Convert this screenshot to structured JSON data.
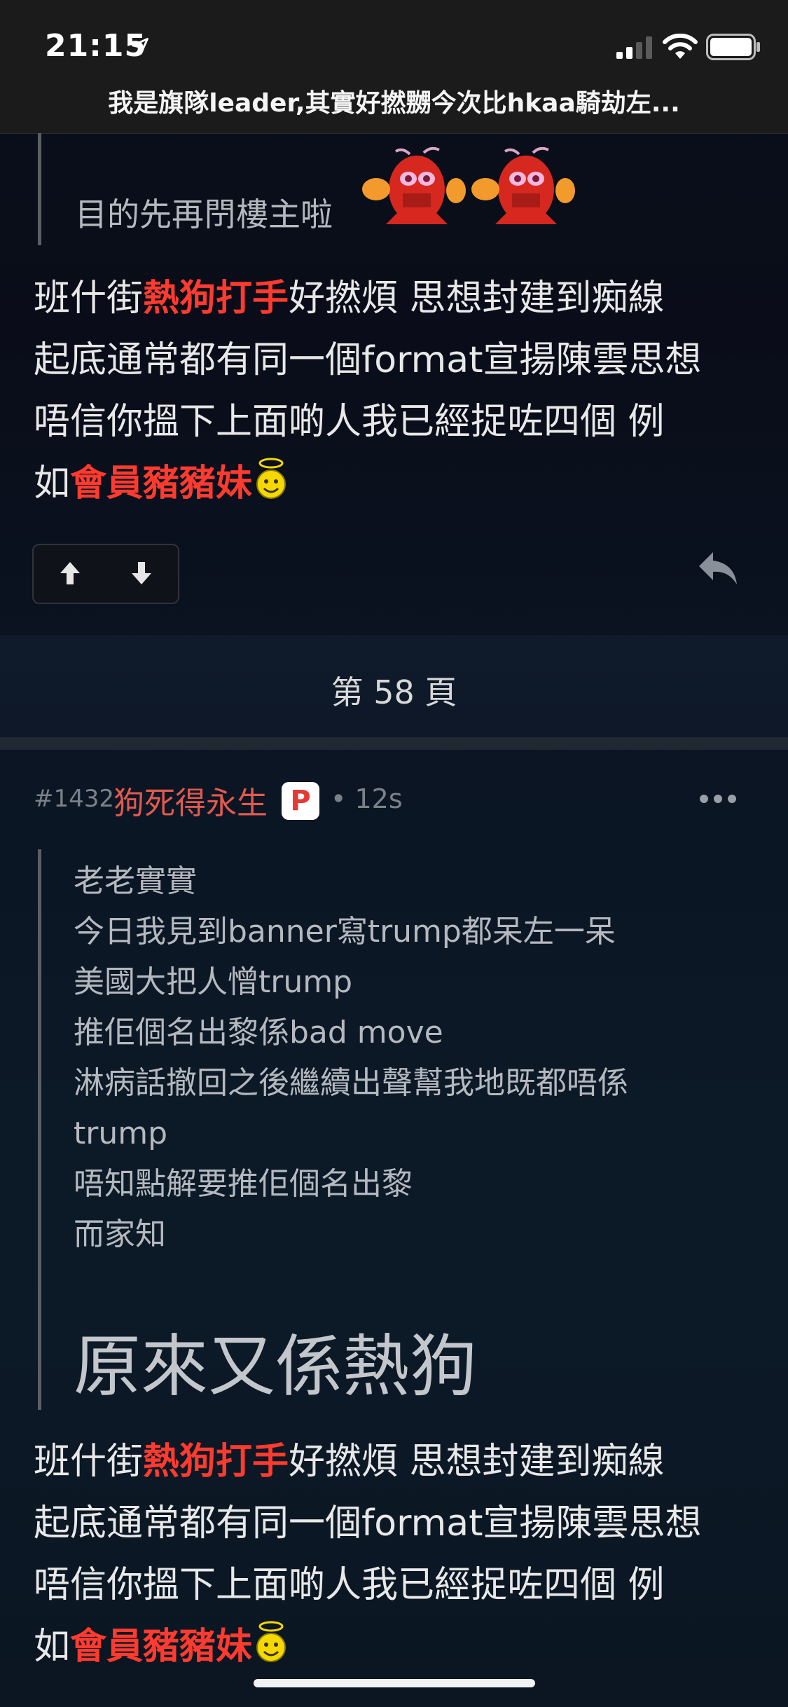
{
  "status_bar": {
    "time": "21:15"
  },
  "thread": {
    "title": "我是旗隊leader,其實好撚嬲今次比hkaa騎劫左..."
  },
  "post1": {
    "quote": "目的先再閅樓主啦",
    "body": {
      "line1": {
        "prefix": "班什街",
        "highlight": "熱狗打手",
        "suffix": "好撚煩 思想封建到痴線"
      },
      "line2": "起底通常都有同一個format宣揚陳雲思想",
      "line3": "唔信你搵下上面啲人我已經捉咗四個 例",
      "line4": {
        "prefix": "如",
        "highlight": "會員豬豬妹"
      }
    }
  },
  "pagination": {
    "label": "第 58 頁"
  },
  "post2": {
    "number": "#1432",
    "author": "狗死得永生",
    "badge": "P",
    "time": "• 12s",
    "quote_lines": [
      "老老實實",
      "今日我見到banner寫trump都呆左一呆",
      "美國大把人憎trump",
      "推佢個名出黎係bad move",
      "淋病話撤回之後繼續出聲幫我地既都唔係",
      "trump",
      "唔知點解要推佢個名出黎",
      "而家知"
    ],
    "quote_big": "原來又係熱狗",
    "body": {
      "line1": {
        "prefix": "班什街",
        "highlight": "熱狗打手",
        "suffix": "好撚煩 思想封建到痴線"
      },
      "line2": "起底通常都有同一個format宣揚陳雲思想",
      "line3": "唔信你搵下上面啲人我已經捉咗四個 例",
      "line4": {
        "prefix": "如",
        "highlight": "會員豬豬妹"
      }
    }
  },
  "colors": {
    "accent_red": "#ff3b30",
    "author_red": "#e05a4f",
    "background": "#0b0f1a"
  }
}
